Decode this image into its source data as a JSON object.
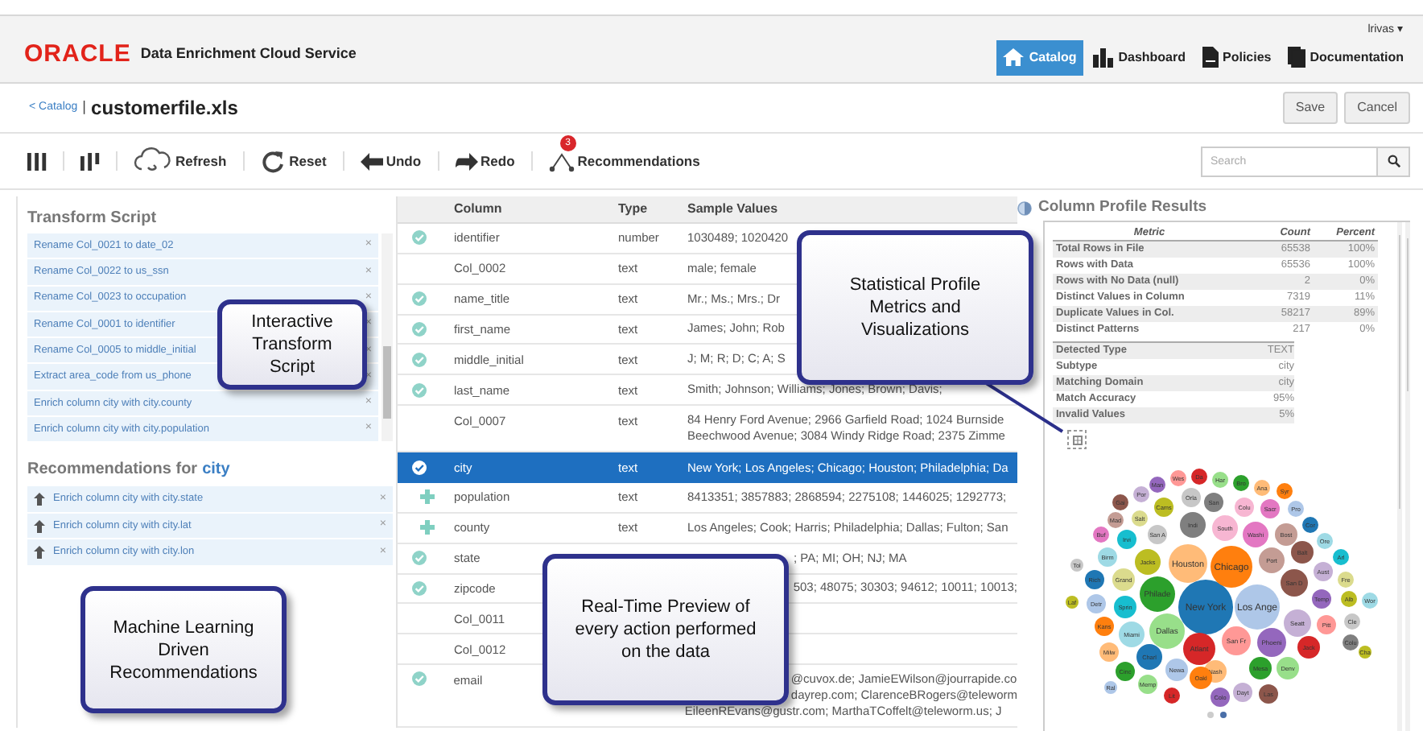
{
  "header": {
    "logo": "ORACLE",
    "product": "Data Enrichment Cloud Service",
    "user": "lrivas ▾",
    "nav": [
      {
        "label": "Catalog",
        "selected": true
      },
      {
        "label": "Dashboard",
        "selected": false
      },
      {
        "label": "Policies",
        "selected": false
      },
      {
        "label": "Documentation",
        "selected": false
      }
    ]
  },
  "breadcrumb": {
    "link": "< Catalog",
    "separator": "|",
    "file": "customerfile.xls",
    "buttons": [
      "Save",
      "Cancel"
    ]
  },
  "toolbar": {
    "items": [
      {
        "kind": "columns"
      },
      {
        "kind": "columns_alt"
      },
      {
        "kind": "refresh",
        "label": "Refresh"
      },
      {
        "kind": "reset",
        "label": "Reset"
      },
      {
        "kind": "undo",
        "label": "Undo"
      },
      {
        "kind": "redo",
        "label": "Redo"
      },
      {
        "kind": "recommendations",
        "label": "Recommendations",
        "badge": "3"
      }
    ],
    "search": {
      "placeholder": "Search"
    }
  },
  "transform_script": {
    "title": "Transform Script",
    "items": [
      {
        "text": "Rename Col_0021 to date_02",
        "close": "×"
      },
      {
        "text": "Rename Col_0022 to us_ssn",
        "close": "×"
      },
      {
        "text": "Rename Col_0023 to occupation",
        "close": "×"
      },
      {
        "text": "Rename Col_0001 to identifier",
        "close": "×"
      },
      {
        "text": "Rename Col_0005 to middle_initial",
        "close": "×"
      },
      {
        "text": "Extract area_code from us_phone",
        "close": "×"
      },
      {
        "text": "Enrich column city with city.county",
        "close": "×"
      },
      {
        "text": "Enrich column city with city.population",
        "close": "×"
      }
    ]
  },
  "recommendations": {
    "title": "Recommendations for",
    "column": "city",
    "items": [
      {
        "text": "Enrich column city with city.state",
        "close": "×"
      },
      {
        "text": "Enrich column city with city.lat",
        "close": "×"
      },
      {
        "text": "Enrich column city with city.lon",
        "close": "×"
      }
    ]
  },
  "table": {
    "columns": [
      "Column",
      "Type",
      "Sample Values"
    ],
    "rows": [
      {
        "kind": "checked",
        "name": "identifier",
        "type": "number",
        "samples": [
          {
            "text": "1030489; 1020420"
          }
        ],
        "selected": false
      },
      {
        "kind": "none",
        "name": "Col_0002",
        "type": "text",
        "samples": [
          {
            "text": "male; female"
          }
        ],
        "selected": false
      },
      {
        "kind": "checked",
        "name": "name_title",
        "type": "text",
        "samples": [
          {
            "text": "Mr.; Ms.; Mrs.; Dr"
          }
        ],
        "selected": false
      },
      {
        "kind": "checked",
        "name": "first_name",
        "type": "text",
        "samples": [
          {
            "text": "James; John; Rob"
          }
        ],
        "selected": false
      },
      {
        "kind": "checked",
        "name": "middle_initial",
        "type": "text",
        "samples": [
          {
            "text": "J; M; R; D; C; A; S"
          }
        ],
        "selected": false
      },
      {
        "kind": "checked",
        "name": "last_name",
        "type": "text",
        "samples": [
          {
            "text": "Smith; Johnson; Williams; Jones; Brown; Davis;"
          }
        ],
        "selected": false
      },
      {
        "kind": "none",
        "name": "Col_0007",
        "type": "text",
        "samples": [
          {
            "text": "84 Henry Ford Avenue; 2966 Garfield Road; 1024 Burnside"
          },
          {
            "text": "Beechwood Avenue; 3084 Windy Ridge Road; 2375 Zimme"
          }
        ],
        "selected": false
      },
      {
        "kind": "checked",
        "name": "city",
        "type": "text",
        "samples": [
          {
            "text": "New York; Los Angeles; Chicago; Houston; Philadelphia; Da"
          }
        ],
        "selected": true
      },
      {
        "kind": "added",
        "name": "population",
        "type": "text",
        "samples": [
          {
            "text": "8413351; 3857883; 2868594; 2275108; 1446025; 1292773;"
          }
        ],
        "selected": false
      },
      {
        "kind": "added",
        "name": "county",
        "type": "text",
        "samples": [
          {
            "text": "Los Angeles; Cook; Harris; Philadelphia; Dallas; Fulton; San"
          }
        ],
        "selected": false
      },
      {
        "kind": "checked",
        "name": "state",
        "samples": [
          {
            "text": "; PA; MI; OH; NJ; MA",
            "indented": true
          }
        ],
        "selected": false
      },
      {
        "kind": "checked",
        "name": "zipcode",
        "samples": [
          {
            "text": "503; 48075; 30303; 94612; 10011; 10013;",
            "indented": true
          }
        ],
        "selected": false
      },
      {
        "kind": "none",
        "name": "Col_0011",
        "selected": false
      },
      {
        "kind": "none",
        "name": "Col_0012",
        "selected": false
      },
      {
        "kind": "checked",
        "name": "email",
        "samples": [
          {
            "text": "@cuvox.de; JamieEWilson@jourrapide.co",
            "indented": true
          },
          {
            "text": "dayrep.com; ClarenceBRogers@teleworm",
            "indented": true
          },
          {
            "text": "EileenREvans@gustr.com; MarthaTCoffelt@teleworm.us; J"
          }
        ],
        "selected": false
      }
    ]
  },
  "profile": {
    "title": "Column Profile Results",
    "columns": [
      "Metric",
      "Count",
      "Percent"
    ],
    "metrics": [
      {
        "metric": "Total Rows in File",
        "count": "65538",
        "percent": "100%"
      },
      {
        "metric": "Rows with Data",
        "count": "65536",
        "percent": "100%"
      },
      {
        "metric": "Rows with No Data (null)",
        "count": "2",
        "percent": "0%"
      },
      {
        "metric": "Distinct Values in Column",
        "count": "7319",
        "percent": "11%"
      },
      {
        "metric": "Duplicate Values in Col.",
        "count": "58217",
        "percent": "89%"
      },
      {
        "metric": "Distinct Patterns",
        "count": "217",
        "percent": "0%"
      }
    ],
    "details": [
      {
        "metric": "Detected Type",
        "value": "TEXT"
      },
      {
        "metric": "Subtype",
        "value": "city"
      },
      {
        "metric": "Matching Domain",
        "value": "city"
      },
      {
        "metric": "Match Accuracy",
        "value": "95%"
      },
      {
        "metric": "Invalid Values",
        "value": "5%"
      }
    ],
    "bubble_chart": {
      "bubbles": [
        {
          "label": "New York",
          "color": "#1f77b4"
        },
        {
          "label": "Los Ange",
          "color": "#aec7e8"
        },
        {
          "label": "Houston",
          "color": "#ffbb78"
        },
        {
          "label": "Chicago",
          "color": "#ff7f0e"
        },
        {
          "label": "Philade",
          "color": "#2ca02c"
        },
        {
          "label": "Dallas",
          "color": "#98df8a"
        },
        {
          "label": "Atlant",
          "color": "#d62728"
        },
        {
          "label": "San Fr",
          "color": "#ff9896"
        },
        {
          "label": "Phoeni",
          "color": "#9467bd"
        },
        {
          "label": "San D",
          "color": "#8c564b"
        },
        {
          "label": "Seatt",
          "color": "#c5b0d5"
        },
        {
          "label": "Port",
          "color": "#c49c94"
        },
        {
          "label": "Indi",
          "color": "#7f7f7f"
        },
        {
          "label": "South",
          "color": "#f7b6d2"
        },
        {
          "label": "Washi",
          "color": "#e377c2"
        },
        {
          "label": "Bost",
          "color": "#c49c94"
        },
        {
          "label": "Jacks",
          "color": "#bcbd22"
        },
        {
          "label": "Grand",
          "color": "#dbdb8d"
        },
        {
          "label": "Sprin",
          "color": "#17becf"
        },
        {
          "label": "Miami",
          "color": "#9edae5"
        },
        {
          "label": "Charl",
          "color": "#1f77b4"
        },
        {
          "label": "Nash",
          "color": "#ffbb78"
        },
        {
          "label": "Oakl",
          "color": "#ff7f0e"
        },
        {
          "label": "Newa",
          "color": "#aec7e8"
        },
        {
          "label": "Memp",
          "color": "#98df8a"
        },
        {
          "label": "Balt",
          "color": "#8c564b"
        },
        {
          "label": "Aust",
          "color": "#c5b0d5"
        },
        {
          "label": "Temp",
          "color": "#9467bd"
        },
        {
          "label": "Jack",
          "color": "#d62728"
        },
        {
          "label": "Pitt",
          "color": "#ff9896"
        },
        {
          "label": "Mesa",
          "color": "#2ca02c"
        },
        {
          "label": "Denv",
          "color": "#98df8a"
        },
        {
          "label": "Colo",
          "color": "#9467bd"
        },
        {
          "label": "Dayt",
          "color": "#c5b0d5"
        },
        {
          "label": "Las",
          "color": "#8c564b"
        },
        {
          "label": "Irvi",
          "color": "#17becf"
        },
        {
          "label": "Birm",
          "color": "#9edae5"
        },
        {
          "label": "Rich",
          "color": "#1f77b4"
        },
        {
          "label": "Detr",
          "color": "#aec7e8"
        },
        {
          "label": "Kans",
          "color": "#ff7f0e"
        },
        {
          "label": "Milw",
          "color": "#ffbb78"
        },
        {
          "label": "Cinc",
          "color": "#2ca02c"
        },
        {
          "label": "San A",
          "color": "#c7c7c7"
        },
        {
          "label": "Cams",
          "color": "#bcbd22"
        },
        {
          "label": "Orla",
          "color": "#c7c7c7"
        },
        {
          "label": "San",
          "color": "#7f7f7f"
        },
        {
          "label": "Colu",
          "color": "#f7b6d2"
        },
        {
          "label": "Sacr",
          "color": "#e377c2"
        },
        {
          "label": "Gai",
          "color": "#8c564b"
        },
        {
          "label": "Por",
          "color": "#c5b0d5"
        },
        {
          "label": "Salt",
          "color": "#dbdb8d"
        },
        {
          "label": "Man",
          "color": "#9467bd"
        },
        {
          "label": "Wes",
          "color": "#ff9896"
        },
        {
          "label": "Da",
          "color": "#d62728"
        },
        {
          "label": "Har",
          "color": "#98df8a"
        },
        {
          "label": "Bro",
          "color": "#2ca02c"
        },
        {
          "label": "Ana",
          "color": "#ffbb78"
        },
        {
          "label": "Syr",
          "color": "#ff7f0e"
        },
        {
          "label": "Pro",
          "color": "#aec7e8"
        },
        {
          "label": "Cor",
          "color": "#1f77b4"
        },
        {
          "label": "Ore",
          "color": "#9edae5"
        },
        {
          "label": "Arl",
          "color": "#17becf"
        },
        {
          "label": "Fre",
          "color": "#dbdb8d"
        },
        {
          "label": "Alb",
          "color": "#bcbd22"
        },
        {
          "label": "Wor",
          "color": "#9edae5"
        },
        {
          "label": "Cle",
          "color": "#c7c7c7"
        },
        {
          "label": "Colu",
          "color": "#7f7f7f"
        },
        {
          "label": "Cha",
          "color": "#bcbd22"
        },
        {
          "label": "Mad",
          "color": "#c49c94"
        },
        {
          "label": "Buf",
          "color": "#e377c2"
        },
        {
          "label": "Tol",
          "color": "#c7c7c7"
        },
        {
          "label": "Laf",
          "color": "#bcbd22"
        },
        {
          "label": "Ral",
          "color": "#aec7e8"
        },
        {
          "label": "Lit",
          "color": "#d62728"
        }
      ]
    }
  },
  "callouts": [
    "Interactive Transform Script",
    "Machine Learning Driven Recommendations",
    "Statistical Profile Metrics and Visualizations",
    "Real-Time Preview of every action performed on the data"
  ]
}
